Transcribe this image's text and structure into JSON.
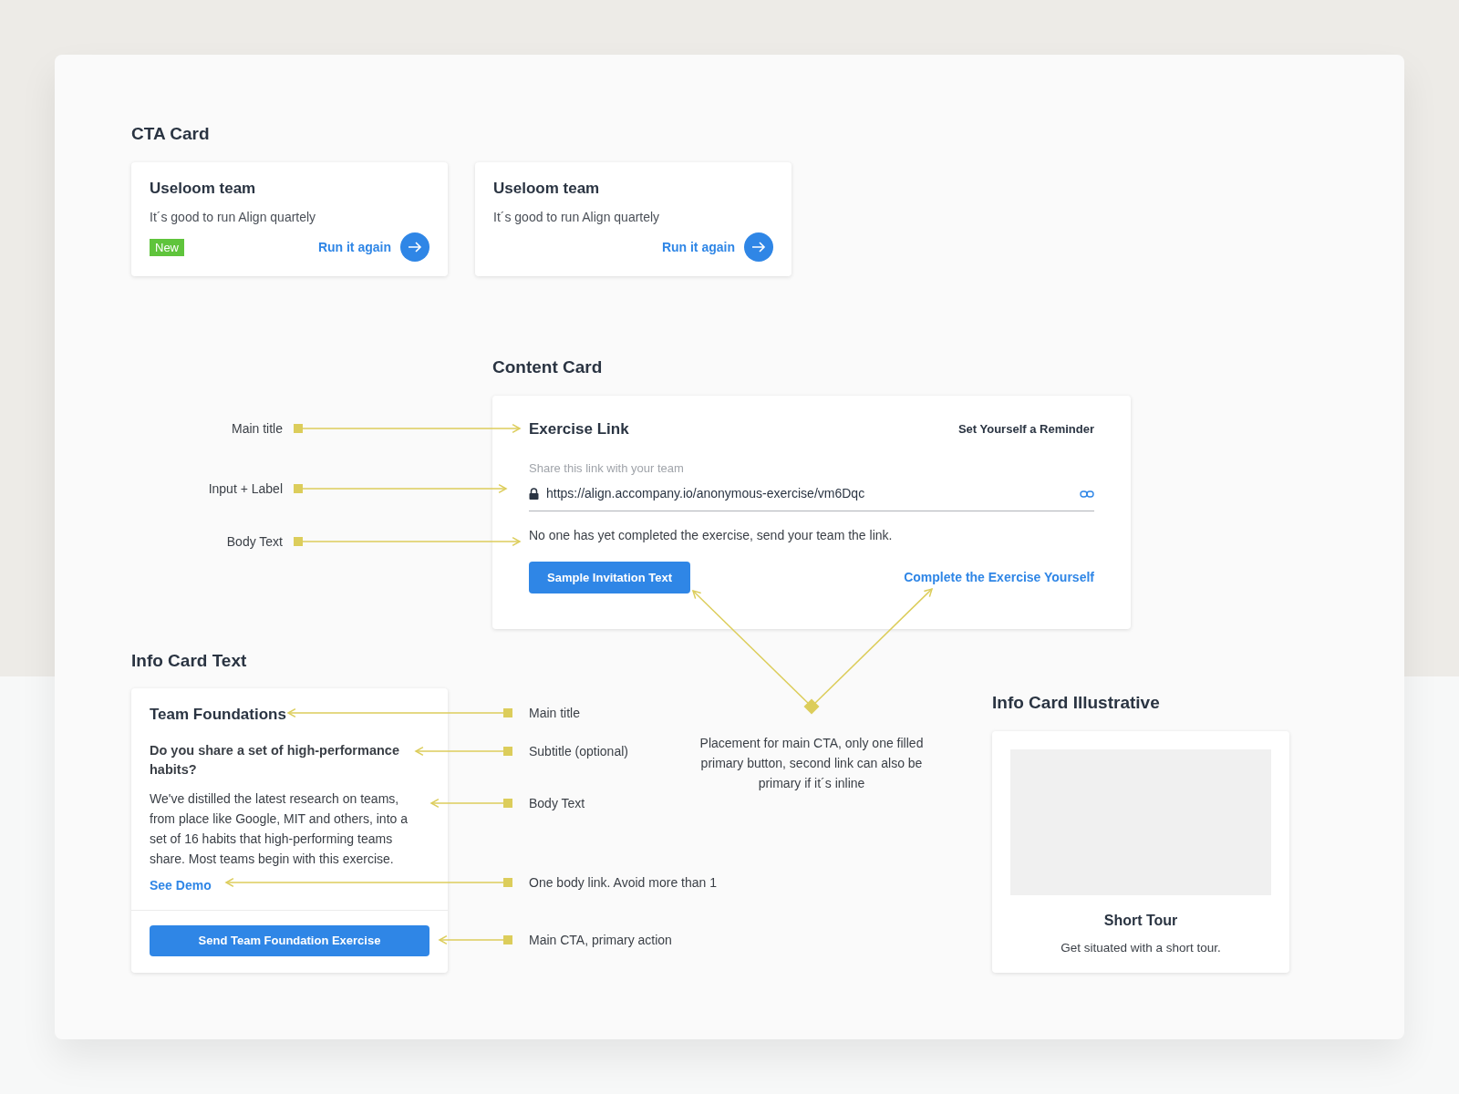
{
  "cta_section": {
    "title": "CTA Card",
    "cards": [
      {
        "title": "Useloom team",
        "subtitle": "It´s good to run Align quartely",
        "badge": "New",
        "link": "Run it again"
      },
      {
        "title": "Useloom team",
        "subtitle": "It´s good to run Align quartely",
        "link": "Run it again"
      }
    ]
  },
  "content_section": {
    "title": "Content Card",
    "card": {
      "title": "Exercise Link",
      "reminder": "Set Yourself a Reminder",
      "input_label": "Share this link with your team",
      "input_value": "https://align.accompany.io/anonymous-exercise/vm6Dqc",
      "body": "No one has yet completed the exercise, send your team the link.",
      "primary_button": "Sample Invitation Text",
      "secondary_link": "Complete the Exercise Yourself"
    }
  },
  "content_annotations": [
    "Main title",
    "Input + Label",
    "Body Text"
  ],
  "cta_note": "Placement for main CTA, only one filled primary button, second link can also be primary if it´s inline",
  "info_text_section": {
    "title": "Info Card Text",
    "card": {
      "title": "Team Foundations",
      "subtitle": "Do you share a set of high-performance habits?",
      "body": "We've distilled the latest research on teams, from place like Google, MIT and others, into a set of 16 habits that high-performing teams share. Most teams begin with this exercise.",
      "link": "See Demo",
      "button": "Send Team Foundation Exercise"
    }
  },
  "info_annotations": [
    "Main title",
    "Subtitle (optional)",
    "Body Text",
    "One body link. Avoid more than 1",
    "Main CTA, primary action"
  ],
  "info_illustrative_section": {
    "title": "Info Card Illustrative",
    "card": {
      "kind": "picture",
      "title": "Short Tour",
      "body": "Get situated with a short tour."
    }
  }
}
